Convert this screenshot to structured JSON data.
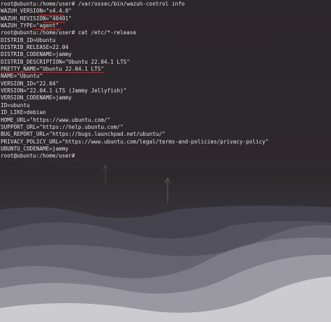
{
  "terminal": {
    "lines": [
      "root@ubuntu:/home/user# /var/ossec/bin/wazuh-control info",
      "WAZUH_VERSION=\"v4.4.0\"",
      "WAZUH_REVISION=\"40401\"",
      "WAZUH_TYPE=\"agent\"",
      "root@ubuntu:/home/user# cat /etc/*-release",
      "DISTRIB_ID=Ubuntu",
      "DISTRIB_RELEASE=22.04",
      "DISTRIB_CODENAME=jammy",
      "DISTRIB_DESCRIPTION=\"Ubuntu 22.04.1 LTS\"",
      "PRETTY_NAME=\"Ubuntu 22.04.1 LTS\"",
      "NAME=\"Ubuntu\"",
      "VERSION_ID=\"22.04\"",
      "VERSION=\"22.04.1 LTS (Jammy Jellyfish)\"",
      "VERSION_CODENAME=jammy",
      "ID=ubuntu",
      "ID_LIKE=debian",
      "HOME_URL=\"https://www.ubuntu.com/\"",
      "SUPPORT_URL=\"https://help.ubuntu.com/\"",
      "BUG_REPORT_URL=\"https://bugs.launchpad.net/ubuntu/\"",
      "PRIVACY_POLICY_URL=\"https://www.ubuntu.com/legal/terms-and-policies/privacy-policy\"",
      "UBUNTU_CODENAME=jammy",
      "root@ubuntu:/home/user# "
    ],
    "underline_color": "#e01b24",
    "text_color": "#e4e4e4"
  },
  "wallpaper": {
    "sky_color": "#2d282b",
    "ridge_colors": [
      "#4a4a55",
      "#5b5a66",
      "#6a6873",
      "#7f7d86",
      "#9b99a1",
      "#cfcfd4"
    ]
  }
}
